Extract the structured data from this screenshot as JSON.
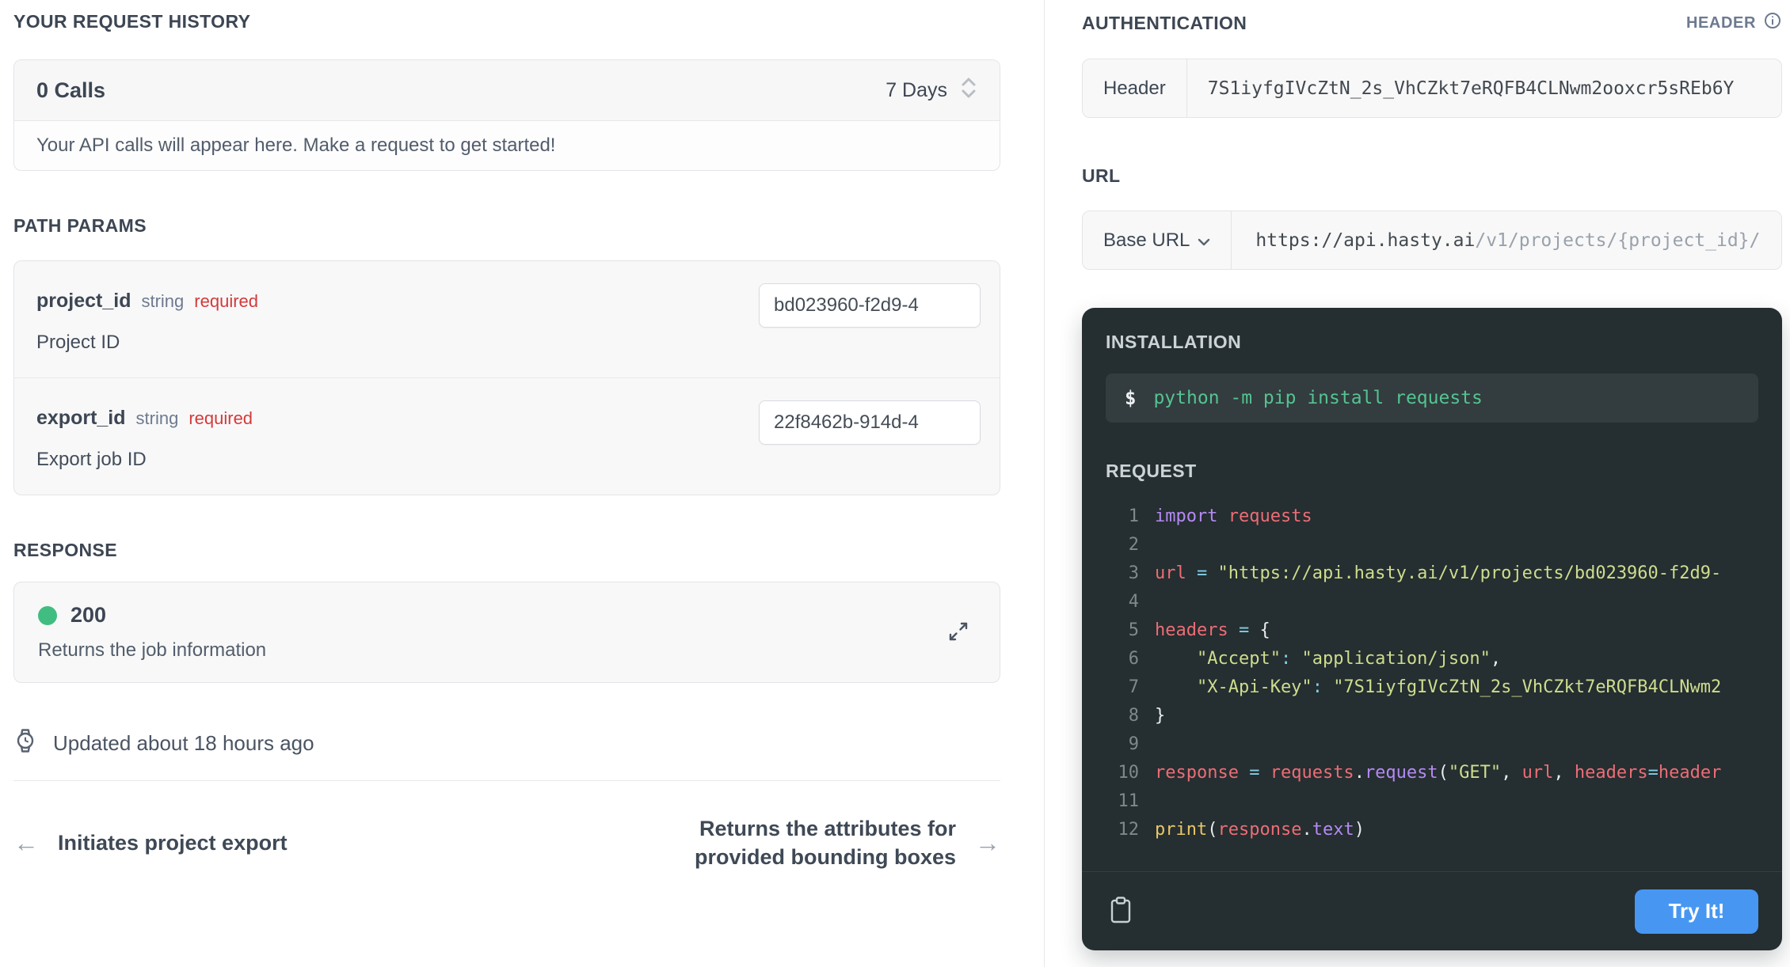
{
  "left": {
    "request_history": {
      "heading": "YOUR REQUEST HISTORY",
      "calls_label": "0 Calls",
      "range_label": "7 Days",
      "empty_message": "Your API calls will appear here. Make a request to get started!"
    },
    "path_params": {
      "heading": "PATH PARAMS",
      "params": [
        {
          "name": "project_id",
          "type": "string",
          "badge": "required",
          "description": "Project ID",
          "value": "bd023960-f2d9-4"
        },
        {
          "name": "export_id",
          "type": "string",
          "badge": "required",
          "description": "Export job ID",
          "value": "22f8462b-914d-4"
        }
      ]
    },
    "response": {
      "heading": "RESPONSE",
      "status_code": "200",
      "status_color": "#41bd81",
      "description": "Returns the job information"
    },
    "updated_text": "Updated about 18 hours ago",
    "pager": {
      "prev_arrow": "←",
      "prev_label": "Initiates project export",
      "next_label": "Returns the attributes for provided bounding boxes",
      "next_arrow": "→"
    }
  },
  "right": {
    "authentication": {
      "heading": "AUTHENTICATION",
      "type_label": "HEADER",
      "field_label": "Header",
      "api_key": "7S1iyfgIVcZtN_2s_VhCZkt7eRQFB4CLNwm2ooxcr5sREb6Y"
    },
    "url": {
      "heading": "URL",
      "base_label": "Base URL",
      "base_url": "https://api.hasty.ai",
      "path": "/v1/projects/{project_id}/"
    },
    "code_panel": {
      "installation_heading": "INSTALLATION",
      "prompt": "$",
      "install_command": "python -m pip install requests",
      "request_heading": "REQUEST",
      "try_button_label": "Try It!",
      "accent_color": "#4797f2",
      "request_lines": [
        {
          "n": "1",
          "tokens": [
            {
              "c": "kw",
              "t": "import "
            },
            {
              "c": "var",
              "t": "requests"
            }
          ]
        },
        {
          "n": "2",
          "tokens": []
        },
        {
          "n": "3",
          "tokens": [
            {
              "c": "var",
              "t": "url"
            },
            {
              "c": "op",
              "t": " = "
            },
            {
              "c": "str",
              "t": "\"https://api.hasty.ai/v1/projects/bd023960-f2d9-"
            }
          ]
        },
        {
          "n": "4",
          "tokens": []
        },
        {
          "n": "5",
          "tokens": [
            {
              "c": "var",
              "t": "headers"
            },
            {
              "c": "op",
              "t": " = "
            },
            {
              "c": "pun",
              "t": "{"
            }
          ]
        },
        {
          "n": "6",
          "tokens": [
            {
              "c": "str",
              "t": "    \"Accept\""
            },
            {
              "c": "op",
              "t": ": "
            },
            {
              "c": "str",
              "t": "\"application/json\""
            },
            {
              "c": "pun",
              "t": ","
            }
          ]
        },
        {
          "n": "7",
          "tokens": [
            {
              "c": "str",
              "t": "    \"X-Api-Key\""
            },
            {
              "c": "op",
              "t": ": "
            },
            {
              "c": "str",
              "t": "\"7S1iyfgIVcZtN_2s_VhCZkt7eRQFB4CLNwm2"
            }
          ]
        },
        {
          "n": "8",
          "tokens": [
            {
              "c": "pun",
              "t": "}"
            }
          ]
        },
        {
          "n": "9",
          "tokens": []
        },
        {
          "n": "10",
          "tokens": [
            {
              "c": "var",
              "t": "response"
            },
            {
              "c": "op",
              "t": " = "
            },
            {
              "c": "var",
              "t": "requests"
            },
            {
              "c": "pun",
              "t": "."
            },
            {
              "c": "fn",
              "t": "request"
            },
            {
              "c": "pun",
              "t": "("
            },
            {
              "c": "str",
              "t": "\"GET\""
            },
            {
              "c": "pun",
              "t": ", "
            },
            {
              "c": "var",
              "t": "url"
            },
            {
              "c": "pun",
              "t": ", "
            },
            {
              "c": "var",
              "t": "headers"
            },
            {
              "c": "op",
              "t": "="
            },
            {
              "c": "var",
              "t": "header"
            }
          ]
        },
        {
          "n": "11",
          "tokens": []
        },
        {
          "n": "12",
          "tokens": [
            {
              "c": "builtin",
              "t": "print"
            },
            {
              "c": "pun",
              "t": "("
            },
            {
              "c": "var",
              "t": "response"
            },
            {
              "c": "pun",
              "t": "."
            },
            {
              "c": "fn",
              "t": "text"
            },
            {
              "c": "pun",
              "t": ")"
            }
          ]
        }
      ]
    }
  }
}
